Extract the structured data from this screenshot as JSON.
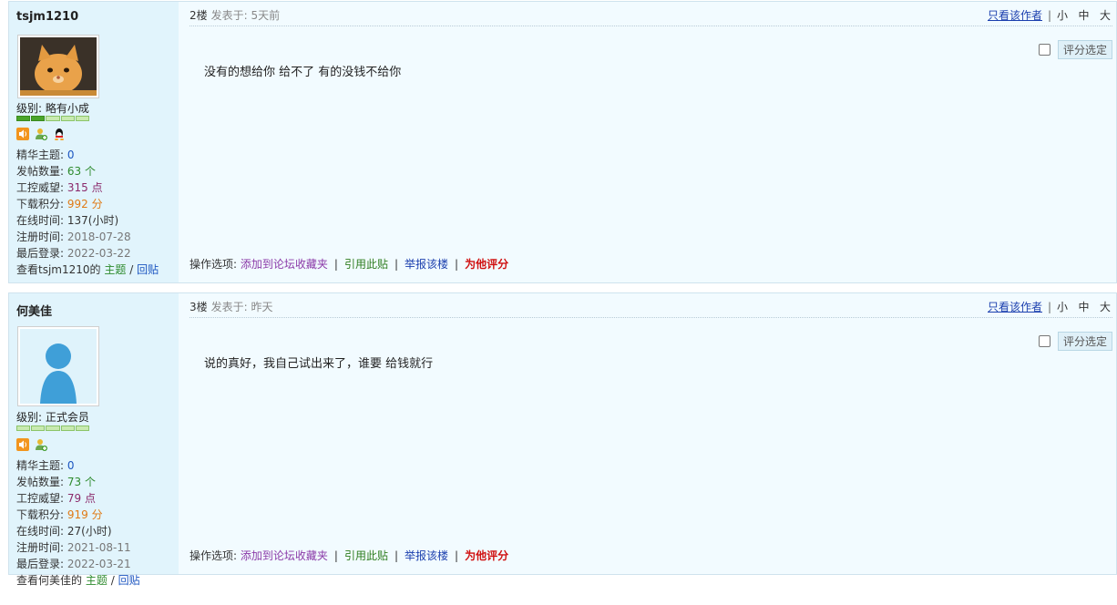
{
  "posts": [
    {
      "username": "tsjm1210",
      "level_label": "级别: 略有小成",
      "stats": {
        "jinghua_label": "精华主题:",
        "jinghua": "0",
        "posts_label": "发帖数量:",
        "posts": "63 个",
        "weiwang_label": "工控威望:",
        "weiwang": "315 点",
        "jifen_label": "下载积分:",
        "jifen": "992 分",
        "online_label": "在线时间:",
        "online": "137(小时)",
        "reg_label": "注册时间:",
        "reg": "2018-07-28",
        "last_label": "最后登录:",
        "last": "2022-03-22"
      },
      "view_prefix": "查看tsjm1210的",
      "topic_link": "主题",
      "slash": "/",
      "reply_link": "回贴",
      "floor": "2楼",
      "post_time": "发表于: 5天前",
      "only_author": "只看该作者",
      "size_small": "小",
      "size_mid": "中",
      "size_big": "大",
      "rate_button": "评分选定",
      "content": "没有的想给你 给不了 有的没钱不给你",
      "ops_label": "操作选项:",
      "op_fav": "添加到论坛收藏夹",
      "op_quote": "引用此贴",
      "op_report": "举报该楼",
      "op_rate": "为他评分"
    },
    {
      "username": "何美佳",
      "level_label": "级别: 正式会员",
      "stats": {
        "jinghua_label": "精华主题:",
        "jinghua": "0",
        "posts_label": "发帖数量:",
        "posts": "73 个",
        "weiwang_label": "工控威望:",
        "weiwang": "79 点",
        "jifen_label": "下载积分:",
        "jifen": "919 分",
        "online_label": "在线时间:",
        "online": "27(小时)",
        "reg_label": "注册时间:",
        "reg": "2021-08-11",
        "last_label": "最后登录:",
        "last": "2022-03-21"
      },
      "view_prefix": "查看何美佳的",
      "topic_link": "主题",
      "slash": "/",
      "reply_link": "回贴",
      "floor": "3楼",
      "post_time": "发表于: 昨天",
      "only_author": "只看该作者",
      "size_small": "小",
      "size_mid": "中",
      "size_big": "大",
      "rate_button": "评分选定",
      "content": "说的真好，我自己试出来了，谁要  给钱就行",
      "ops_label": "操作选项:",
      "op_fav": "添加到论坛收藏夹",
      "op_quote": "引用此贴",
      "op_report": "举报该楼",
      "op_rate": "为他评分"
    }
  ],
  "colors": {
    "post_bg": "#f2fbff",
    "sidebar_bg": "#e1f4fc",
    "link_blue": "#1b3fae",
    "rate_red": "#d01010"
  },
  "icons": [
    "speaker-icon",
    "add-friend-icon",
    "qq-penguin-icon"
  ]
}
